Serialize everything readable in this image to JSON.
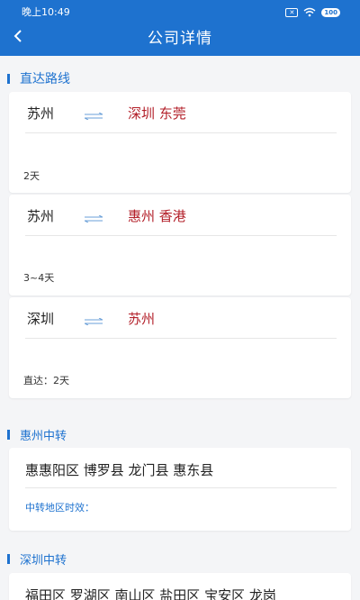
{
  "status": {
    "time": "晚上10:49",
    "sim": "✕",
    "battery": "100"
  },
  "header": {
    "title": "公司详情"
  },
  "sections": {
    "direct": {
      "title": "直达路线"
    },
    "huizhou": {
      "title": "惠州中转",
      "areas": "惠惠阳区 博罗县 龙门县 惠东县",
      "sub": "中转地区时效："
    },
    "shenzhen": {
      "title": "深圳中转",
      "areas": "福田区 罗湖区 南山区 盐田区 宝安区 龙岗"
    }
  },
  "routes": [
    {
      "from": "苏州",
      "to": "深圳 东莞",
      "duration": "2天"
    },
    {
      "from": "苏州",
      "to": "惠州 香港",
      "duration": "3~4天"
    },
    {
      "from": "深圳",
      "to": "苏州",
      "duration": "直达：2天"
    }
  ],
  "colors": {
    "primary": "#1e72cf",
    "destination": "#b3202a",
    "background": "#f4f5f7"
  },
  "icons": {
    "back": "chevron-left-icon",
    "route_arrow": "exchange-arrows-icon",
    "wifi": "wifi-icon"
  }
}
